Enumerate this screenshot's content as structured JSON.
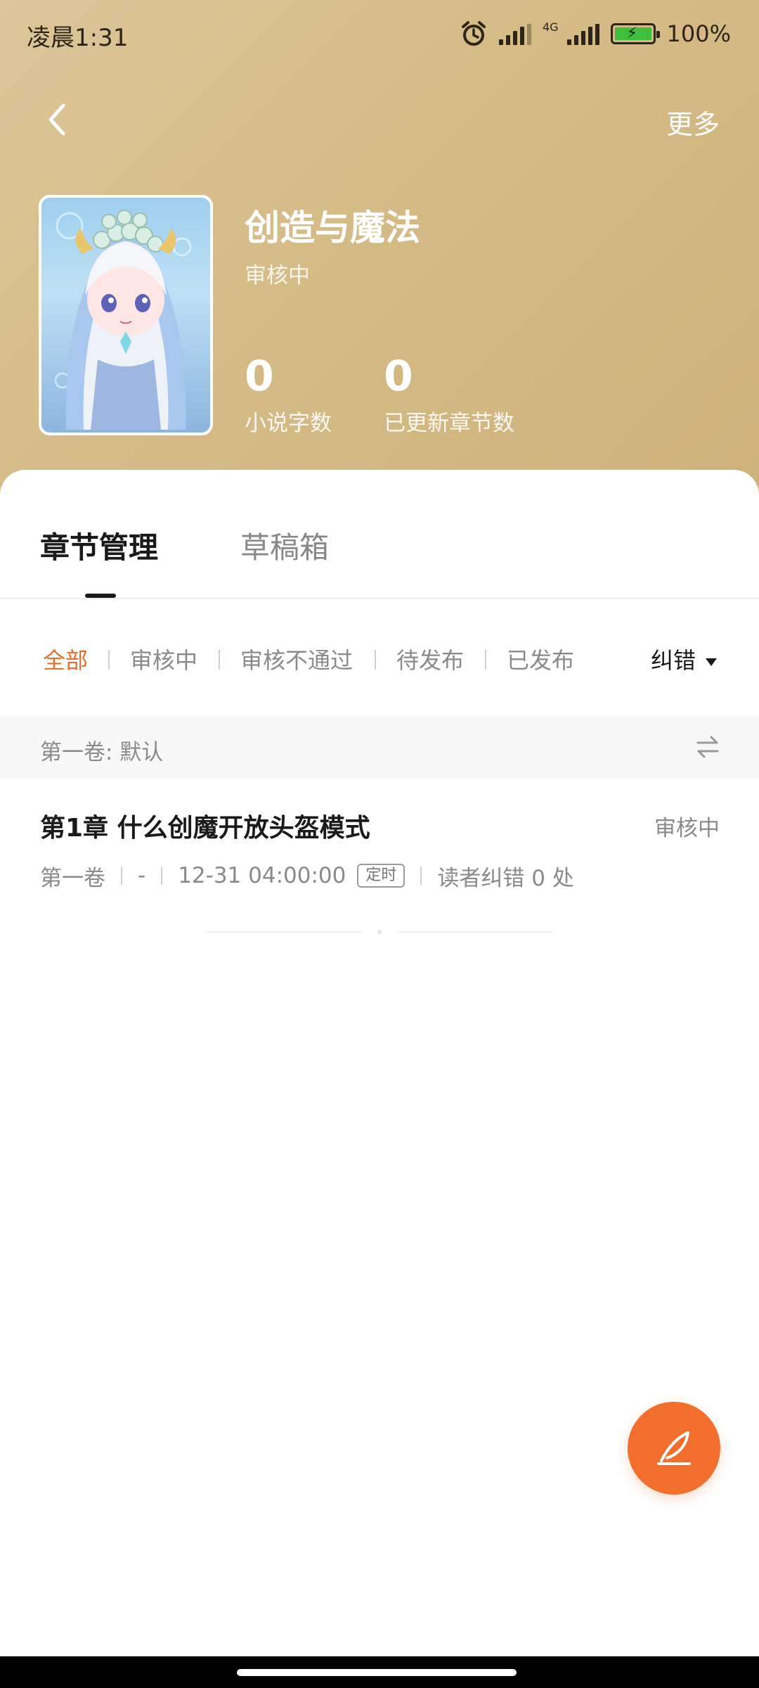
{
  "status_bar": {
    "time": "凌晨1:31",
    "network": "4G",
    "battery": "100%",
    "battery_level": 1.0
  },
  "header": {
    "more_label": "更多"
  },
  "book": {
    "title": "创造与魔法",
    "status": "审核中",
    "stats": [
      {
        "value": "0",
        "label": "小说字数"
      },
      {
        "value": "0",
        "label": "已更新章节数"
      }
    ]
  },
  "tabs": [
    {
      "label": "章节管理",
      "active": true
    },
    {
      "label": "草稿箱",
      "active": false
    }
  ],
  "filters": [
    {
      "label": "全部",
      "active": true
    },
    {
      "label": "审核中",
      "active": false
    },
    {
      "label": "审核不通过",
      "active": false
    },
    {
      "label": "待发布",
      "active": false
    },
    {
      "label": "已发布",
      "active": false
    }
  ],
  "sort": {
    "label": "纠错"
  },
  "volume": {
    "label": "第一卷: 默认"
  },
  "chapters": [
    {
      "title": "第1章 什么创魔开放头盔模式",
      "status": "审核中",
      "volume": "第一卷",
      "word_count": "-",
      "scheduled_time": "12-31 04:00:00",
      "badge": "定时",
      "corrections": "读者纠错 0 处"
    }
  ],
  "colors": {
    "accent": "#e56f2c",
    "fab": "#f26e2c",
    "header_gold": "#d5bb86"
  },
  "icons": {
    "back": "chevron-left-icon",
    "swap": "swap-icon",
    "write": "feather-pen-icon",
    "alarm": "alarm-icon"
  }
}
